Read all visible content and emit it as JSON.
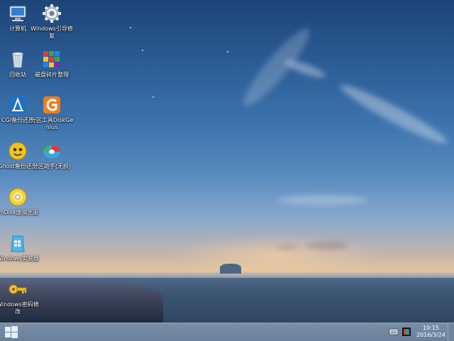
{
  "desktop": {
    "icons": [
      {
        "label": "计算机",
        "icon": "computer-icon"
      },
      {
        "label": "Windows引导修复",
        "icon": "gear-icon"
      },
      {
        "label": "回收站",
        "icon": "recycle-bin-icon"
      },
      {
        "label": "磁盘碎片整理",
        "icon": "defrag-icon"
      },
      {
        "label": "CGI备份还原",
        "icon": "cgi-backup-icon"
      },
      {
        "label": "分区工具DiskGenius",
        "icon": "diskgenius-icon"
      },
      {
        "label": "Ghost备份还原",
        "icon": "ghost-icon"
      },
      {
        "label": "分区助手(无损)",
        "icon": "partition-assistant-icon"
      },
      {
        "label": "ImDisk虚拟光驱",
        "icon": "virtual-drive-icon"
      },
      {
        "label": "Windows安装器",
        "icon": "installer-icon"
      },
      {
        "label": "Windows密码修改",
        "icon": "key-icon"
      }
    ]
  },
  "taskbar": {
    "start_icon": "windows-logo-icon",
    "tray_icons": [
      "keyboard-icon",
      "color-display-icon"
    ],
    "time": "10:15",
    "date": "2016/3/24"
  },
  "colors": {
    "taskbar": "#6a7f9a",
    "sky_top": "#1c4478",
    "horizon": "#e3c6a1"
  }
}
